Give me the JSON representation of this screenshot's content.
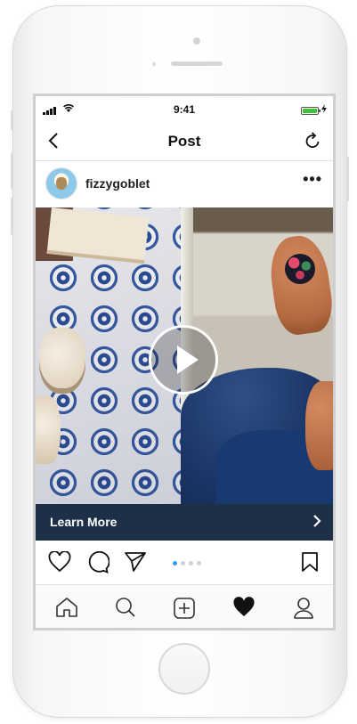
{
  "status_bar": {
    "time": "9:41"
  },
  "nav": {
    "title": "Post"
  },
  "post": {
    "username": "fizzygoblet",
    "more": "•••"
  },
  "cta": {
    "label": "Learn More"
  },
  "carousel": {
    "count": 4,
    "active_index": 0
  },
  "colors": {
    "cta_bg": "#1e2f48",
    "accent_dot": "#3897f0",
    "battery": "#3fc238"
  },
  "icons": {
    "nav": [
      "back-chevron-icon",
      "refresh-icon"
    ],
    "actions": [
      "heart-icon",
      "comment-icon",
      "share-icon",
      "bookmark-icon"
    ],
    "tabs": [
      "home-icon",
      "search-icon",
      "add-icon",
      "activity-heart-icon",
      "profile-icon"
    ]
  }
}
